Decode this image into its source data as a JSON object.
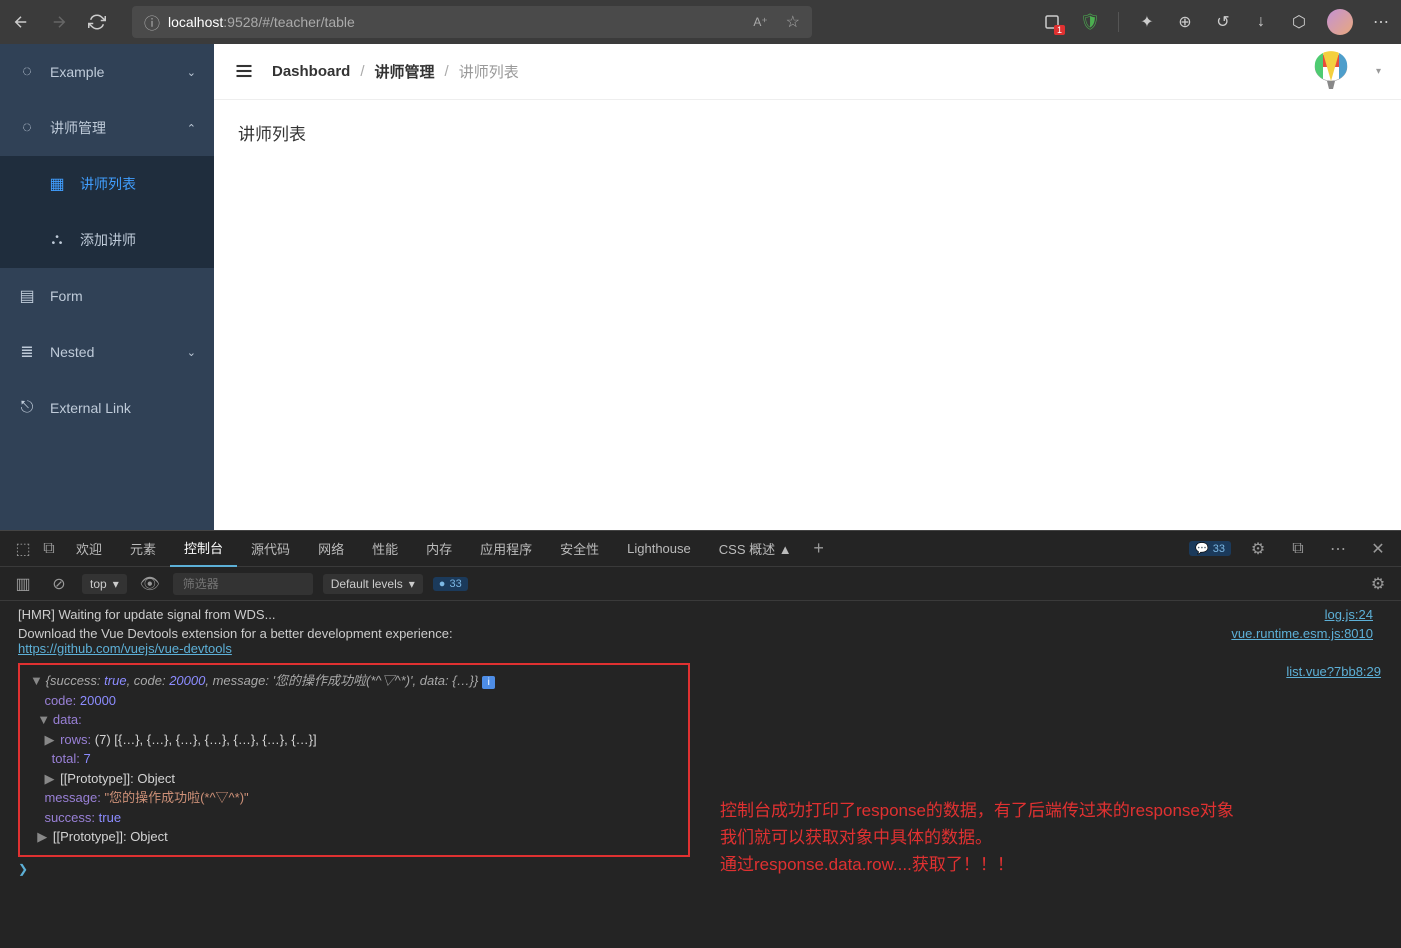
{
  "browser": {
    "url_host": "localhost",
    "url_path": ":9528/#/teacher/table",
    "badge_count": "1"
  },
  "sidebar": {
    "items": [
      {
        "label": "Example",
        "chev": "⌄"
      },
      {
        "label": "讲师管理",
        "chev": "⌃"
      },
      {
        "label": "讲师列表"
      },
      {
        "label": "添加讲师"
      },
      {
        "label": "Form"
      },
      {
        "label": "Nested",
        "chev": "⌄"
      },
      {
        "label": "External Link"
      }
    ]
  },
  "breadcrumb": {
    "item1": "Dashboard",
    "item2": "讲师管理",
    "item3": "讲师列表",
    "sep": "/"
  },
  "content": {
    "title": "讲师列表"
  },
  "devtools": {
    "tabs": [
      "欢迎",
      "元素",
      "控制台",
      "源代码",
      "网络",
      "性能",
      "内存",
      "应用程序",
      "安全性",
      "Lighthouse",
      "CSS 概述 ▲"
    ],
    "msg_count": "33",
    "context": "top",
    "filter_placeholder": "筛选器",
    "levels": "Default levels",
    "issues_count": "33"
  },
  "console": {
    "line1": "[HMR] Waiting for update signal from WDS...",
    "src1": "log.js:24",
    "line2": "Download the Vue Devtools extension for a better development experience:",
    "line2_link": "https://github.com/vuejs/vue-devtools",
    "src2": "vue.runtime.esm.js:8010",
    "src3": "list.vue?7bb8:29",
    "obj_summary_pre": "{success: ",
    "obj_true": "true",
    "obj_code_lbl": ", code: ",
    "obj_code_val": "20000",
    "obj_msg_lbl": ", message: ",
    "obj_msg_val": "'您的操作成功啦(*^▽^*)'",
    "obj_data_lbl": ", data: ",
    "obj_data_val": "{…}",
    "obj_close": "}",
    "prop_code_k": "code:",
    "prop_code_v": "20000",
    "prop_data_k": "data:",
    "prop_rows_k": "rows:",
    "prop_rows_v": "(7) [{…}, {…}, {…}, {…}, {…}, {…}, {…}]",
    "prop_total_k": "total:",
    "prop_total_v": "7",
    "prop_proto_k": "[[Prototype]]:",
    "prop_proto_v": "Object",
    "prop_msg_k": "message:",
    "prop_msg_v": "\"您的操作成功啦(*^▽^*)\"",
    "prop_success_k": "success:",
    "prop_success_v": "true"
  },
  "annotation": {
    "line1": "控制台成功打印了response的数据，有了后端传过来的response对象",
    "line2": "我们就可以获取对象中具体的数据。",
    "line3": "通过response.data.row....获取了！！！"
  }
}
